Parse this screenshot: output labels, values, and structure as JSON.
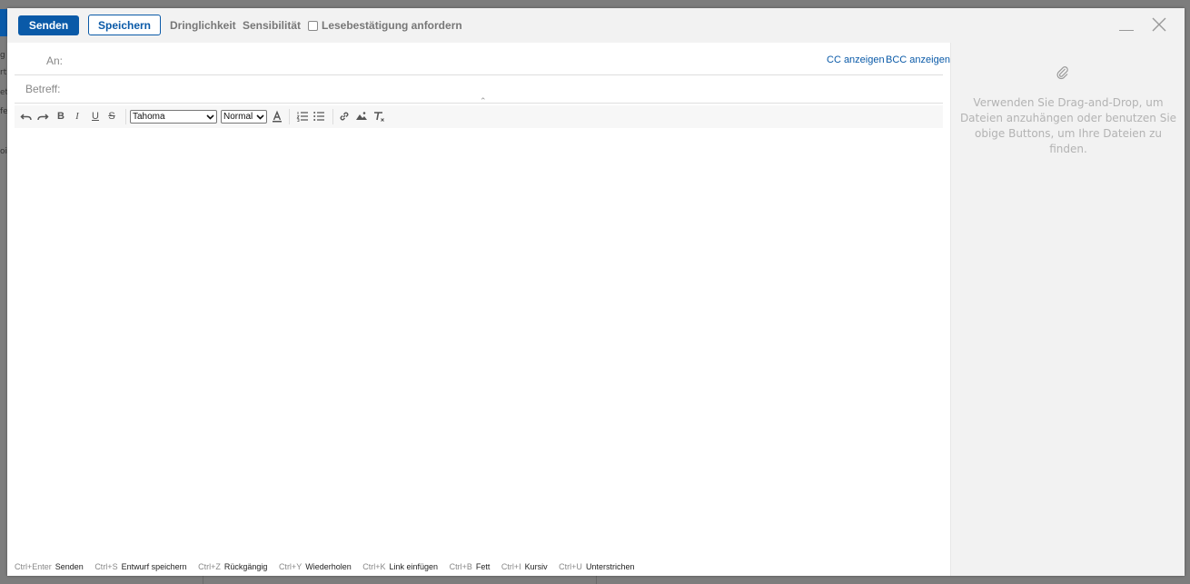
{
  "toolbar": {
    "send_label": "Senden",
    "save_label": "Speichern",
    "urgency_label": "Dringlichkeit",
    "sensitivity_label": "Sensibilität",
    "read_receipt_label": "Lesebestätigung anfordern",
    "read_receipt_checked": false
  },
  "fields": {
    "to_label": "An:",
    "subject_label": "Betreff:",
    "cc_link": "CC anzeigen",
    "bcc_link": "BCC anzeigen"
  },
  "editor": {
    "font_family": "Tahoma",
    "font_size": "Normal",
    "icons": [
      "undo-icon",
      "redo-icon",
      "bold-icon",
      "italic-icon",
      "underline-icon",
      "strikethrough-icon",
      "text-color-icon",
      "ordered-list-icon",
      "unordered-list-icon",
      "link-icon",
      "image-icon",
      "clear-format-icon"
    ]
  },
  "shortcuts": [
    {
      "keys": "Ctrl+Enter",
      "label": "Senden"
    },
    {
      "keys": "Ctrl+S",
      "label": "Entwurf speichern"
    },
    {
      "keys": "Ctrl+Z",
      "label": "Rückgängig"
    },
    {
      "keys": "Ctrl+Y",
      "label": "Wiederholen"
    },
    {
      "keys": "Ctrl+K",
      "label": "Link einfügen"
    },
    {
      "keys": "Ctrl+B",
      "label": "Fett"
    },
    {
      "keys": "Ctrl+I",
      "label": "Kursiv"
    },
    {
      "keys": "Ctrl+U",
      "label": "Unterstrichen"
    }
  ],
  "attachments": {
    "hint": "Verwenden Sie Drag-and-Drop, um Dateien anzuhängen oder benutzen Sie obige Buttons, um Ihre Dateien zu finden."
  },
  "background": {
    "fragments": [
      "g",
      "rt",
      "et",
      "fe",
      "oi"
    ]
  },
  "colors": {
    "accent": "#0a5aa8",
    "toolbar_bg": "#f2f2f2",
    "muted_text": "#888888",
    "hint_text": "#b3b3b3"
  }
}
